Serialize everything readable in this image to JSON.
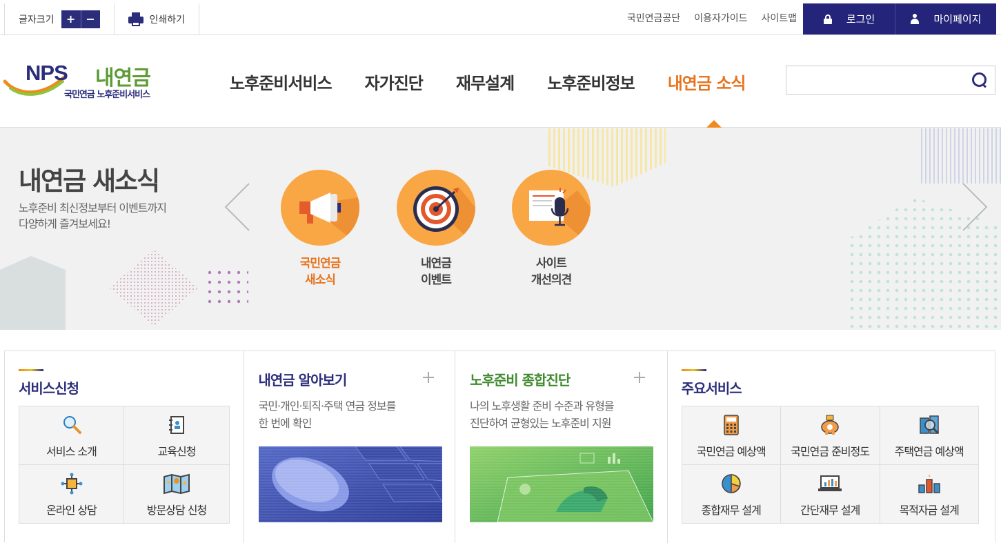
{
  "topbar": {
    "font_size_label": "글자크기",
    "font_plus": "+",
    "font_minus": "−",
    "print_label": "인쇄하기",
    "links": [
      "국민연금공단",
      "이용자가이드",
      "사이트맵"
    ],
    "login_label": "로그인",
    "mypage_label": "마이페이지"
  },
  "logo": {
    "nps_text": "NPS",
    "brand_text": "내연금",
    "sub_text": "국민연금 노후준비서비스"
  },
  "gnb": {
    "items": [
      {
        "label": "노후준비서비스",
        "active": false
      },
      {
        "label": "자가진단",
        "active": false
      },
      {
        "label": "재무설계",
        "active": false
      },
      {
        "label": "노후준비정보",
        "active": false
      },
      {
        "label": "내연금 소식",
        "active": true
      }
    ]
  },
  "search": {
    "placeholder": ""
  },
  "visual": {
    "title": "내연금 새소식",
    "desc_line1": "노후준비 최신정보부터 이벤트까지",
    "desc_line2": "다양하게 즐겨보세요!",
    "items": [
      {
        "line1": "국민연금",
        "line2": "새소식",
        "icon": "megaphone-icon",
        "active": true
      },
      {
        "line1": "내연금",
        "line2": "이벤트",
        "icon": "target-icon",
        "active": false
      },
      {
        "line1": "사이트",
        "line2": "개선의견",
        "icon": "microphone-icon",
        "active": false
      }
    ]
  },
  "panels": {
    "service_apply": {
      "title": "서비스신청",
      "items": [
        {
          "label": "서비스 소개",
          "icon": "magnifier-icon"
        },
        {
          "label": "교육신청",
          "icon": "notebook-icon"
        },
        {
          "label": "온라인 상담",
          "icon": "network-icon"
        },
        {
          "label": "방문상담 신청",
          "icon": "map-icon"
        }
      ]
    },
    "pension_info": {
      "title": "내연금 알아보기",
      "desc_line1": "국민·개인·퇴직·주택 연금 정보를",
      "desc_line2": "한 번에 확인"
    },
    "diagnosis": {
      "title": "노후준비 종합진단",
      "desc_line1": "나의 노후생활 준비 수준과 유형을",
      "desc_line2": "진단하여 균형있는 노후준비 지원"
    },
    "main_services": {
      "title": "주요서비스",
      "items": [
        {
          "label": "국민연금 예상액",
          "icon": "calculator-icon"
        },
        {
          "label": "국민연금 준비정도",
          "icon": "piggy-bank-icon"
        },
        {
          "label": "주택연금 예상액",
          "icon": "building-search-icon"
        },
        {
          "label": "종합재무 설계",
          "icon": "pie-chart-icon"
        },
        {
          "label": "간단재무 설계",
          "icon": "laptop-chart-icon"
        },
        {
          "label": "목적자금 설계",
          "icon": "bar-chart-icon"
        }
      ]
    }
  },
  "colors": {
    "navy": "#2b2d7b",
    "orange": "#e7731e",
    "circle": "#f9a645",
    "green": "#3f8b2e"
  }
}
